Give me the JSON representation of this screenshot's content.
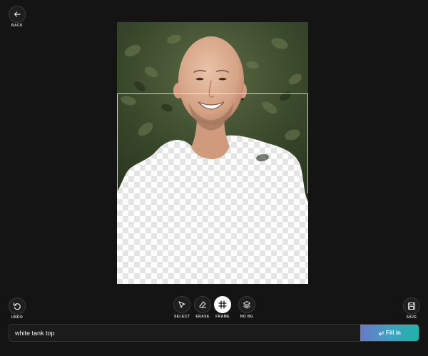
{
  "header": {
    "back_label": "BACK",
    "back_icon": "arrow-left-icon"
  },
  "canvas": {
    "image_content": "photo of smiling bald man with foliage background; body area erased to transparency",
    "background": "transparent-checkerboard"
  },
  "toolbar": {
    "undo_label": "UNDO",
    "save_label": "SAVE",
    "tools": [
      {
        "label": "SELECT",
        "icon": "cursor-icon",
        "active": false
      },
      {
        "label": "ERASE",
        "icon": "eraser-icon",
        "active": false
      },
      {
        "label": "FRAME",
        "icon": "frame-icon",
        "active": true
      },
      {
        "label": "NO BG",
        "icon": "layers-icon",
        "active": false
      }
    ]
  },
  "prompt": {
    "value": "white tank top",
    "button_label": "Fill in",
    "button_icon": "return-arrow-icon"
  },
  "colors": {
    "background": "#141414",
    "accent_gradient_start": "#6b78c9",
    "accent_gradient_end": "#1db5a5"
  }
}
